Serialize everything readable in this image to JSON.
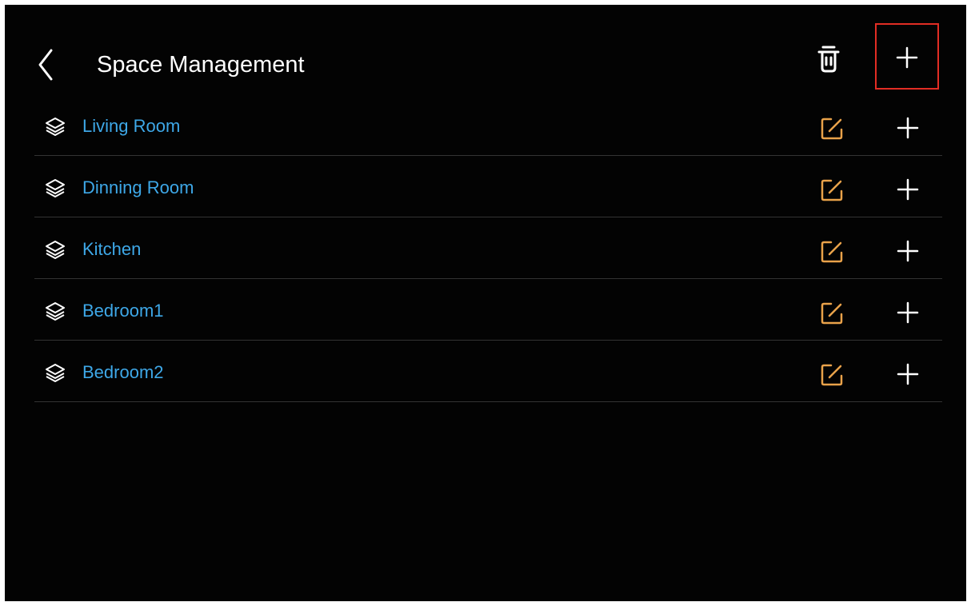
{
  "header": {
    "title": "Space Management",
    "back_icon": "chevron-left-icon",
    "delete_icon": "trash-icon",
    "add_icon": "plus-icon",
    "highlight_color": "#e22d24"
  },
  "rooms": [
    {
      "name": "Living Room",
      "icon": "layers-icon",
      "edit_icon": "edit-icon",
      "add_icon": "plus-icon"
    },
    {
      "name": "Dinning Room",
      "icon": "layers-icon",
      "edit_icon": "edit-icon",
      "add_icon": "plus-icon"
    },
    {
      "name": "Kitchen",
      "icon": "layers-icon",
      "edit_icon": "edit-icon",
      "add_icon": "plus-icon"
    },
    {
      "name": "Bedroom1",
      "icon": "layers-icon",
      "edit_icon": "edit-icon",
      "add_icon": "plus-icon"
    },
    {
      "name": "Bedroom2",
      "icon": "layers-icon",
      "edit_icon": "edit-icon",
      "add_icon": "plus-icon"
    }
  ],
  "colors": {
    "background": "#030303",
    "room_name": "#3ea8e8",
    "edit_icon": "#e9a24a",
    "divider": "#333333",
    "text": "#ffffff"
  }
}
